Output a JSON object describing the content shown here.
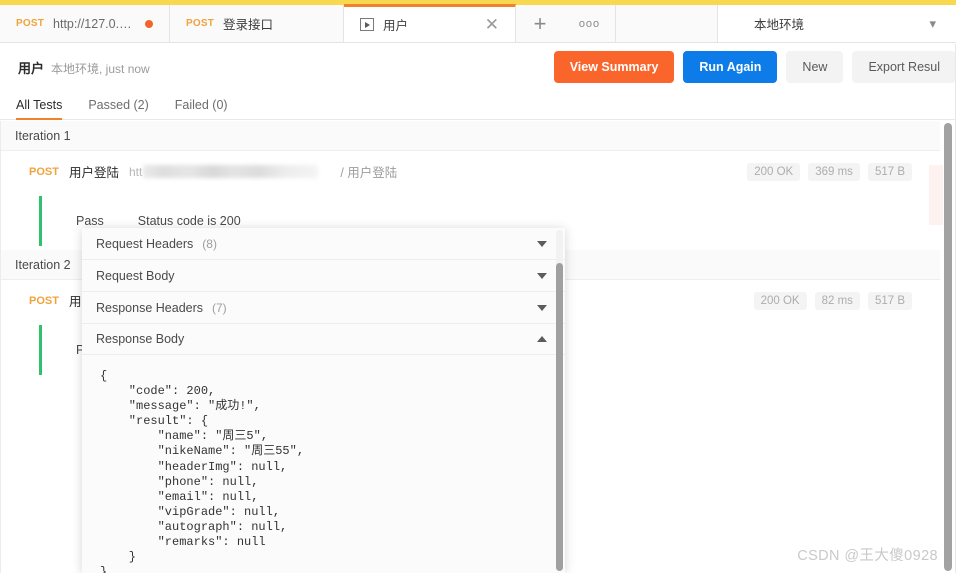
{
  "window": {
    "tabs": [
      {
        "method": "POST",
        "title": "http://127.0.0.1:5...",
        "dirty": true,
        "active": false
      },
      {
        "method": "POST",
        "title": "登录接口",
        "dirty": false,
        "active": false
      },
      {
        "method": "RUN",
        "title": "用户",
        "dirty": false,
        "active": true
      }
    ],
    "new_tab_label": "+",
    "more_tabs_label": "ooo",
    "environment": "本地环境",
    "environment_chevron": "chevron-down"
  },
  "header": {
    "title": "用户",
    "subtitle": "本地环境, just now",
    "buttons": [
      {
        "label": "View Summary",
        "style": "orange"
      },
      {
        "label": "Run Again",
        "style": "blue"
      },
      {
        "label": "New",
        "style": "gray"
      },
      {
        "label": "Export Resul",
        "style": "gray"
      }
    ]
  },
  "subtabs": [
    {
      "label": "All Tests",
      "active": true
    },
    {
      "label": "Passed (2)",
      "active": false
    },
    {
      "label": "Failed (0)",
      "active": false
    }
  ],
  "iterations": [
    {
      "heading": "Iteration 1",
      "request": {
        "method": "POST",
        "name": "用户登陆",
        "url_prefix": "htt",
        "url_redacted": true,
        "path": "/ 用户登陆",
        "status": "200 OK",
        "time": "369 ms",
        "size": "517 B"
      },
      "assertion": {
        "result": "Pass",
        "text": "Status code is 200"
      }
    },
    {
      "heading": "Iteration 2",
      "request": {
        "method": "POST",
        "name": "用户",
        "url_prefix": "",
        "url_redacted": false,
        "path": "",
        "status": "200 OK",
        "time": "82 ms",
        "size": "517 B"
      },
      "assertion": {
        "result": "Pass",
        "text": ""
      }
    }
  ],
  "popup": {
    "sections": [
      {
        "label": "Request Headers",
        "count": "(8)",
        "expanded": false
      },
      {
        "label": "Request Body",
        "count": "",
        "expanded": false
      },
      {
        "label": "Response Headers",
        "count": "(7)",
        "expanded": false
      },
      {
        "label": "Response Body",
        "count": "",
        "expanded": true
      }
    ],
    "response_body": "{\n    \"code\": 200,\n    \"message\": \"成功!\",\n    \"result\": {\n        \"name\": \"周三5\",\n        \"nikeName\": \"周三55\",\n        \"headerImg\": null,\n        \"phone\": null,\n        \"email\": null,\n        \"vipGrade\": null,\n        \"autograph\": null,\n        \"remarks\": null\n    }\n}"
  },
  "watermark": "CSDN @王大傻0928",
  "colors": {
    "accent_orange": "#f2812c",
    "btn_orange": "#f9652b",
    "btn_blue": "#0d7ce8",
    "pass_green": "#2dc26b",
    "method_orange": "#f0a33d",
    "top_strip": "#f7d84f"
  }
}
